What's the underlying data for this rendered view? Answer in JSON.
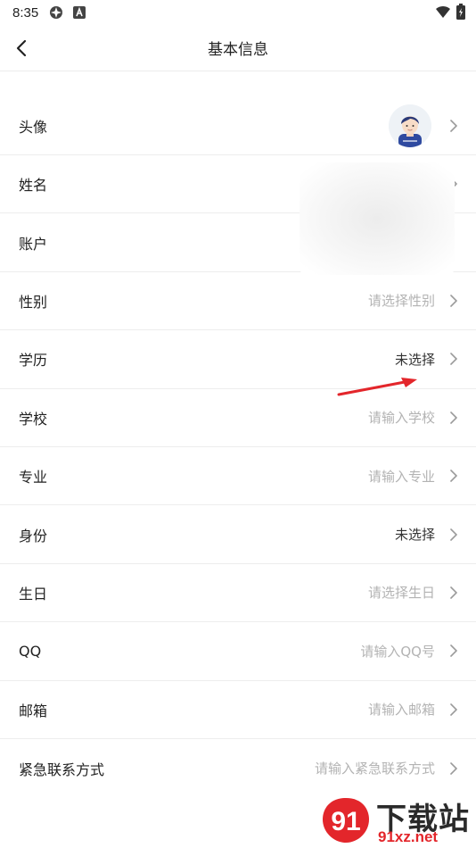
{
  "status_bar": {
    "time": "8:35"
  },
  "nav": {
    "title": "基本信息"
  },
  "rows": [
    {
      "label": "头像",
      "value": "",
      "style": "avatar"
    },
    {
      "label": "姓名",
      "value": "",
      "style": "blurred"
    },
    {
      "label": "账户",
      "value": "",
      "style": "blurred"
    },
    {
      "label": "性别",
      "value": "请选择性别",
      "style": "placeholder"
    },
    {
      "label": "学历",
      "value": "未选择",
      "style": "filled"
    },
    {
      "label": "学校",
      "value": "请输入学校",
      "style": "placeholder"
    },
    {
      "label": "专业",
      "value": "请输入专业",
      "style": "placeholder"
    },
    {
      "label": "身份",
      "value": "未选择",
      "style": "filled"
    },
    {
      "label": "生日",
      "value": "请选择生日",
      "style": "placeholder"
    },
    {
      "label": "QQ",
      "value": "请输入QQ号",
      "style": "placeholder"
    },
    {
      "label": "邮箱",
      "value": "请输入邮箱",
      "style": "placeholder"
    },
    {
      "label": "紧急联系方式",
      "value": "请输入紧急联系方式",
      "style": "placeholder"
    }
  ],
  "watermark": {
    "text": "下载站",
    "url": "91xz.net"
  },
  "colors": {
    "accent_red": "#e3262b",
    "placeholder": "#b3b3b3"
  }
}
